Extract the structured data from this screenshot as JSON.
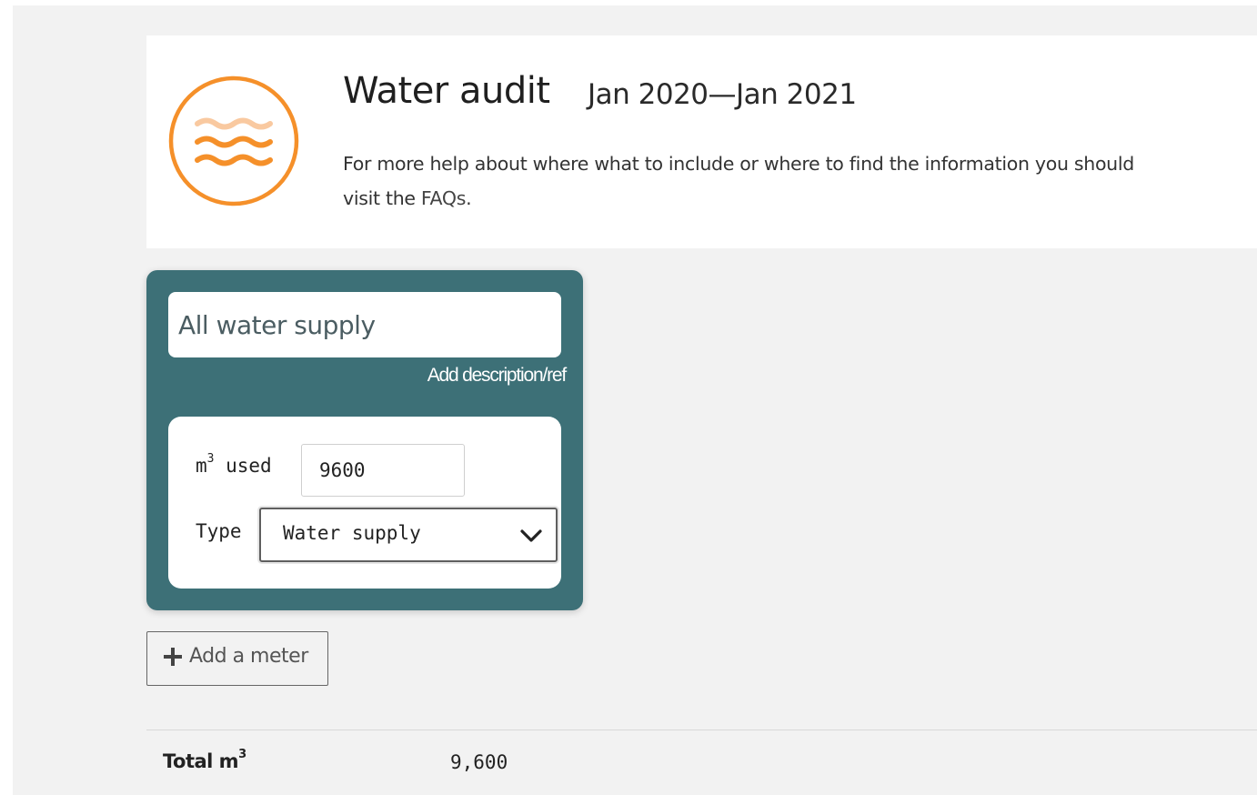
{
  "header": {
    "title": "Water audit",
    "period": "Jan 2020—Jan 2021",
    "help_text": "For more help about where what to include or where to find the information you should visit the ",
    "faq_link": "FAQs",
    "help_tail": ".",
    "logo_icon": "water-waves-icon",
    "accent_color": "#f5902a"
  },
  "meter": {
    "name_value": "All water supply",
    "add_description_label": "Add description/ref",
    "used_label": "m",
    "used_sup": "3",
    "used_suffix": " used",
    "used_value": "9600",
    "type_label": "Type",
    "type_value": "Water supply",
    "card_color": "#3d7077"
  },
  "actions": {
    "add_meter_label": "Add a meter"
  },
  "totals": {
    "label": "Total m",
    "label_sup": "3",
    "value": "9,600"
  }
}
